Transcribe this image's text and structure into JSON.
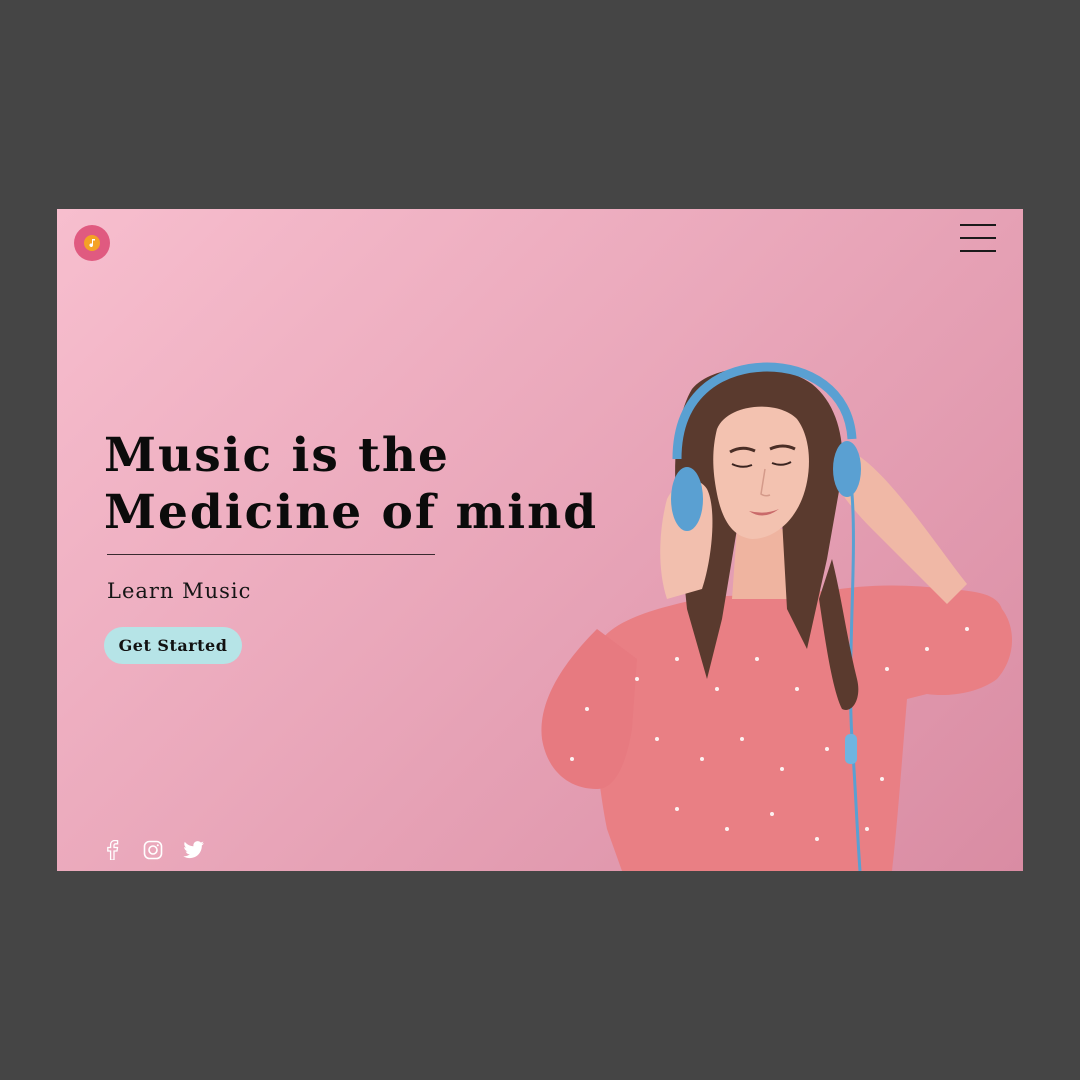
{
  "header": {
    "logo_icon": "music-note-icon",
    "menu_icon": "hamburger-menu-icon"
  },
  "hero": {
    "headline_line1": "Music is the",
    "headline_line2": "Medicine of mind",
    "subtitle": "Learn Music",
    "cta_label": "Get Started",
    "image": "woman-with-headphones-photo"
  },
  "social": [
    {
      "icon": "facebook-icon"
    },
    {
      "icon": "instagram-icon"
    },
    {
      "icon": "twitter-icon"
    }
  ],
  "colors": {
    "background_outer": "#454545",
    "gradient_start": "#f7bece",
    "gradient_end": "#d98ca3",
    "logo": "#e05a80",
    "cta": "#b6e4e7",
    "headphones": "#5aa0d2",
    "shirt": "#e97f84"
  }
}
